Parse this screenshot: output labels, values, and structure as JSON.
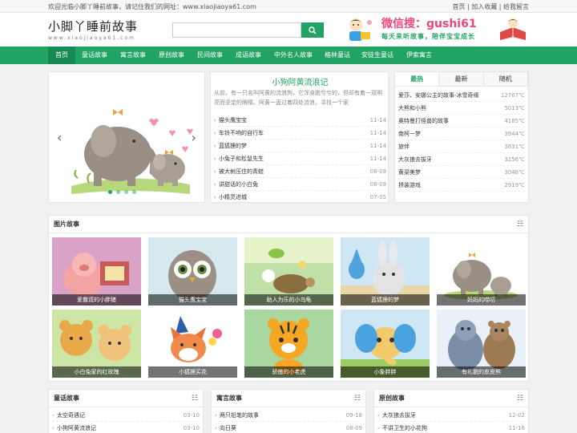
{
  "topbar": {
    "welcome": "欢迎光临小脚丫睡前故事，请记住我们的网址：www.xiaojiaoya61.com",
    "home": "首页",
    "favorite": "加入收藏",
    "message": "给我留言",
    "sep": " | "
  },
  "logo": {
    "name": "小脚丫睡前故事",
    "url": "www.xiaojiaoya61.com"
  },
  "search": {
    "placeholder": ""
  },
  "wechat": {
    "line1": "微信搜：gushi61",
    "line2": "每天来听故事，陪伴宝宝成长"
  },
  "nav": [
    "首页",
    "童话故事",
    "寓言故事",
    "原创故事",
    "民间故事",
    "成语故事",
    "中外名人故事",
    "格林童话",
    "安徒生童话",
    "伊索寓言"
  ],
  "slider": {
    "prev": "‹",
    "next": "›"
  },
  "featured": {
    "title": "小狗阿黄流浪记",
    "desc": "从前，有一只名叫阿黄的流浪狗，它浑身脏兮兮的，但却有着一双明亮而坚定的眼睛。阿黄一直过着四处流浪，寻找一个家",
    "items": [
      {
        "title": "猫头鹰宝宝",
        "date": "11-14"
      },
      {
        "title": "车铃不响的自行车",
        "date": "11-14"
      },
      {
        "title": "蓝狐狸的梦",
        "date": "11-14"
      },
      {
        "title": "小兔子和松鼠先生",
        "date": "11-14"
      },
      {
        "title": "被大树压住的青蛙",
        "date": "08-09"
      },
      {
        "title": "讲甜话的小白兔",
        "date": "08-09"
      },
      {
        "title": "小精灵进城",
        "date": "07-05"
      }
    ]
  },
  "ranking": {
    "tabs": [
      "最热",
      "最新",
      "随机"
    ],
    "items": [
      {
        "title": "爱莎、安娜公主的故事-冰雪奇缘",
        "count": "12767℃"
      },
      {
        "title": "大熊和小熊",
        "count": "5013℃"
      },
      {
        "title": "奥特曼打怪兽的故事",
        "count": "4185℃"
      },
      {
        "title": "南柯一梦",
        "count": "3944℃"
      },
      {
        "title": "旅伴",
        "count": "3831℃"
      },
      {
        "title": "大灰狼去拔牙",
        "count": "3256℃"
      },
      {
        "title": "黄梁美梦",
        "count": "3048℃"
      },
      {
        "title": "拼装游戏",
        "count": "2919℃"
      }
    ]
  },
  "gallery": {
    "title": "图片故事",
    "menu": "☷",
    "items": [
      "爱撒谎的小胖猪",
      "猫头鹰宝宝",
      "助人为乐的小乌龟",
      "蓝狐狸的梦",
      "妈妈的唠叨",
      "小白兔家的红玫瑰",
      "小狐狸买花",
      "骄傲的小老虎",
      "小象胖胖",
      "有礼貌的皮皮熊"
    ]
  },
  "lists": [
    {
      "title": "童话故事",
      "items": [
        {
          "title": "太空奇遇记",
          "date": "03-10"
        },
        {
          "title": "小狗阿黄流浪记",
          "date": "03-10"
        }
      ]
    },
    {
      "title": "寓言故事",
      "items": [
        {
          "title": "两只铅笔的故事",
          "date": "09-18"
        },
        {
          "title": "向日葵",
          "date": "08-09"
        }
      ]
    },
    {
      "title": "原创故事",
      "items": [
        {
          "title": "大灰狼去拔牙",
          "date": "12-02"
        },
        {
          "title": "不讲卫生的小花狗",
          "date": "11-16"
        }
      ]
    }
  ],
  "colors": {
    "brand": "#21a365",
    "brand_dark": "#168a52",
    "accent": "#e8487a"
  }
}
